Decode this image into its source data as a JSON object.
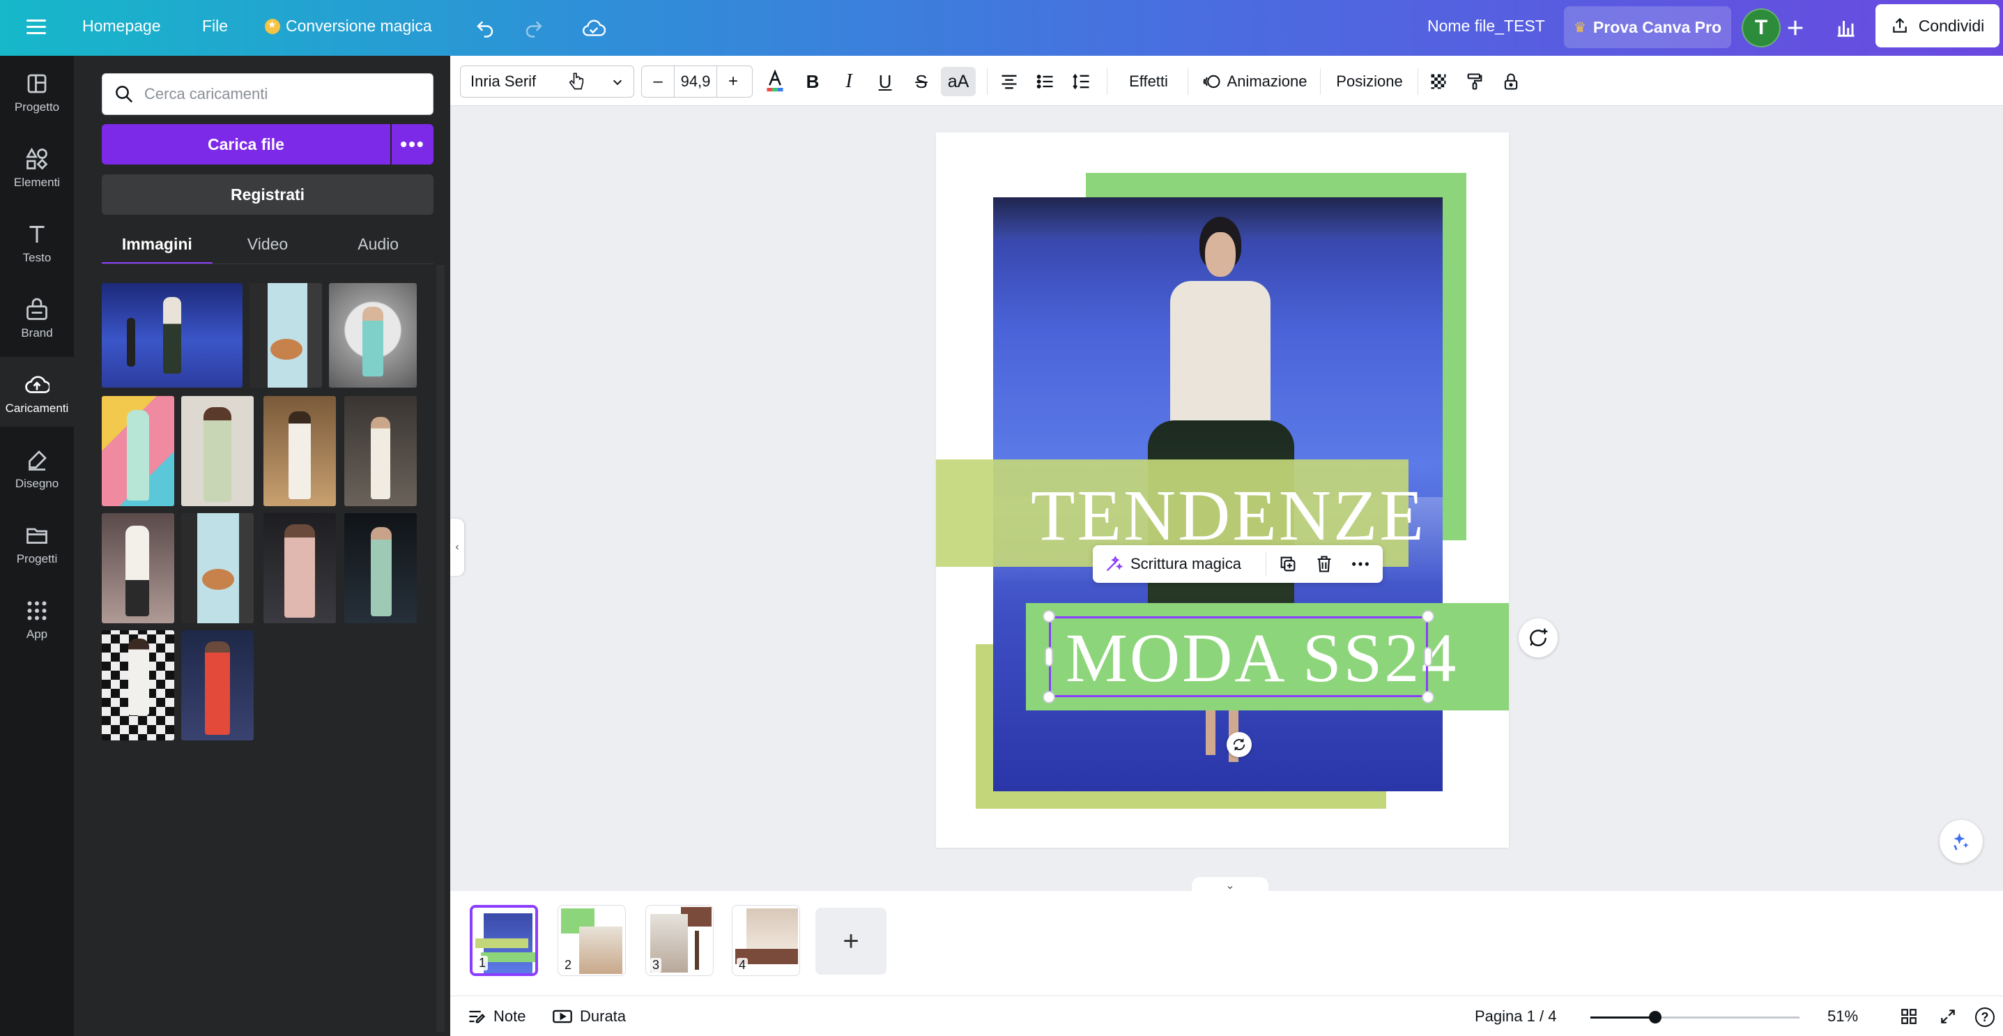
{
  "topbar": {
    "home": "Homepage",
    "file": "File",
    "magic": "Conversione magica",
    "filename": "Nome file_TEST",
    "pro": "Prova Canva Pro",
    "avatar_letter": "T",
    "share": "Condividi"
  },
  "rail": [
    {
      "label": "Progetto",
      "icon": "layout-icon"
    },
    {
      "label": "Elementi",
      "icon": "shapes-icon"
    },
    {
      "label": "Testo",
      "icon": "text-icon"
    },
    {
      "label": "Brand",
      "icon": "brand-icon"
    },
    {
      "label": "Caricamenti",
      "icon": "upload-icon",
      "active": true
    },
    {
      "label": "Disegno",
      "icon": "draw-icon"
    },
    {
      "label": "Progetti",
      "icon": "folder-icon"
    },
    {
      "label": "App",
      "icon": "apps-icon"
    }
  ],
  "panel": {
    "search_placeholder": "Cerca caricamenti",
    "upload": "Carica file",
    "record": "Registrati",
    "tabs": [
      "Immagini",
      "Video",
      "Audio"
    ],
    "active_tab": "Immagini"
  },
  "toolbar": {
    "font": "Inria Serif",
    "size": "94,9",
    "minus": "–",
    "plus": "+",
    "effects": "Effetti",
    "animation": "Animazione",
    "position": "Posizione"
  },
  "canvas": {
    "line1": "TENDENZE",
    "line2": "MODA SS24",
    "magic_write": "Scrittura magica"
  },
  "pages": [
    "1",
    "2",
    "3",
    "4"
  ],
  "footer": {
    "notes": "Note",
    "duration": "Durata",
    "page": "Pagina 1 / 4",
    "zoom": "51%",
    "zoom_fraction": 0.51,
    "help": "?"
  },
  "colors": {
    "accent": "#8b3dff",
    "green_light": "#c3d77a",
    "green": "#8dd57a",
    "dark": "#18191b"
  }
}
